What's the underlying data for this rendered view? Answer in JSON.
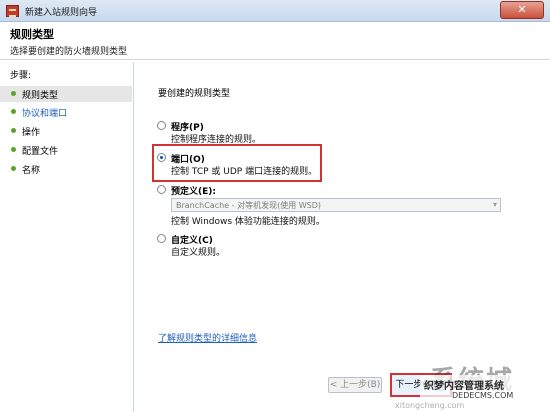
{
  "window": {
    "title": "新建入站规则向导",
    "close_label": "✕"
  },
  "header": {
    "title": "规则类型",
    "subtitle": "选择要创建的防火墙规则类型"
  },
  "steps": {
    "heading": "步骤:",
    "items": [
      {
        "label": "规则类型"
      },
      {
        "label": "协议和端口"
      },
      {
        "label": "操作"
      },
      {
        "label": "配置文件"
      },
      {
        "label": "名称"
      }
    ]
  },
  "main": {
    "prompt": "要创建的规则类型",
    "options": [
      {
        "title": "程序(P)",
        "desc": "控制程序连接的规则。",
        "selected": false
      },
      {
        "title": "端口(O)",
        "desc": "控制 TCP 或 UDP 端口连接的规则。",
        "selected": true
      },
      {
        "title": "预定义(E):",
        "desc": "控制 Windows 体验功能连接的规则。",
        "selected": false
      },
      {
        "title": "自定义(C)",
        "desc": "自定义规则。",
        "selected": false
      }
    ],
    "predefined_value": "BranchCache - 对等机发现(使用 WSD)",
    "learn_link": "了解规则类型的详细信息"
  },
  "buttons": {
    "back": "< 上一步(B)",
    "next": "下一步(N) >"
  },
  "watermark": {
    "logo": "系统城",
    "line1": "织梦内容管理系统",
    "line2": "DEDECMS.COM",
    "line3": "xitongcheng.com"
  },
  "colors": {
    "highlight": "#d03236",
    "link": "#1f5fbf",
    "step_dot": "#58a428"
  }
}
